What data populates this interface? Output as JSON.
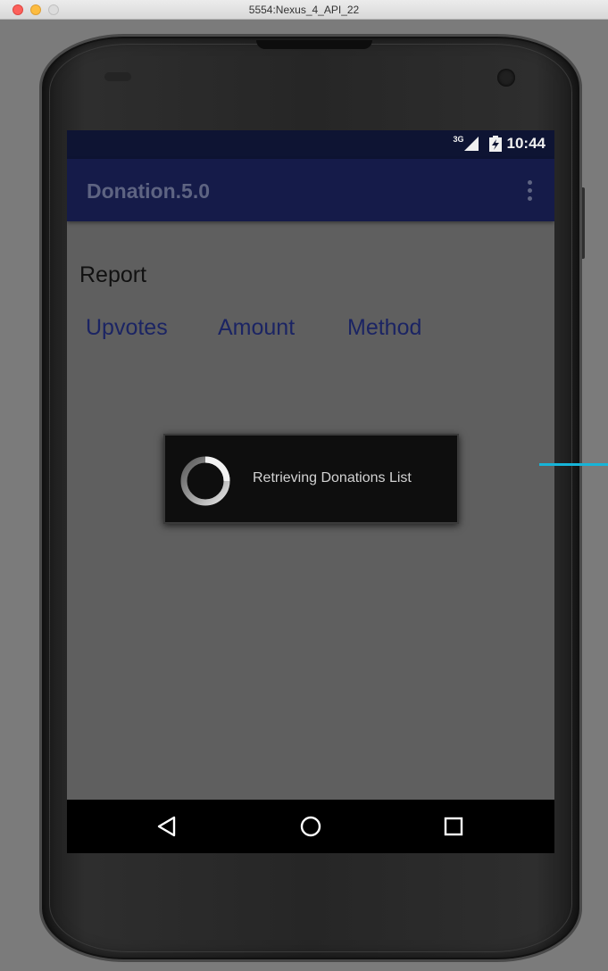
{
  "window": {
    "title": "5554:Nexus_4_API_22"
  },
  "statusbar": {
    "network_label": "3G",
    "time": "10:44"
  },
  "appbar": {
    "title": "Donation.5.0",
    "menu_icon": "overflow-menu-icon"
  },
  "content": {
    "heading": "Report",
    "columns": [
      "Upvotes",
      "Amount",
      "Method"
    ]
  },
  "dialog": {
    "message": "Retrieving Donations List",
    "icon": "progress-spinner-icon"
  },
  "navbar": {
    "back_icon": "back-triangle-icon",
    "home_icon": "home-circle-icon",
    "recents_icon": "recents-square-icon"
  },
  "colors": {
    "appbar": "#151b49",
    "statusbar": "#0e1433",
    "accent_line": "#16b4d8",
    "column_text": "#1b2463"
  }
}
